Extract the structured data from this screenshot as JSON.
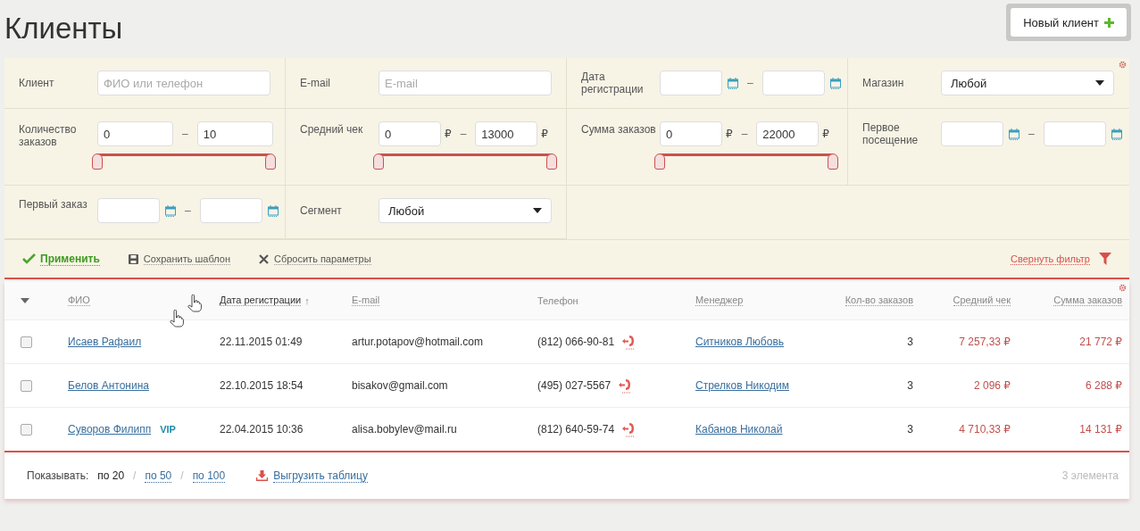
{
  "page": {
    "title": "Клиенты",
    "new_button": "Новый клиент"
  },
  "filters": [
    {
      "kind": "text",
      "label": "Клиент",
      "placeholder": "ФИО или телефон"
    },
    {
      "kind": "text",
      "label": "E-mail",
      "placeholder": "E-mail"
    },
    {
      "kind": "date_range",
      "label": "Дата регистрации",
      "dash": "–"
    },
    {
      "kind": "select",
      "label": "Магазин",
      "value": "Любой"
    },
    {
      "kind": "number_range",
      "label": "Количество заказов",
      "from": "0",
      "to": "10",
      "dash": "–",
      "thumbs": [
        {
          "level": 0
        },
        {
          "level": 1
        }
      ]
    },
    {
      "kind": "number_range",
      "label": "Средний чек",
      "from": "0",
      "to": "13000",
      "dash": "–",
      "currency": "₽",
      "thumbs": [
        {
          "level": 0
        },
        {
          "level": 1
        }
      ]
    },
    {
      "kind": "number_range",
      "label": "Сумма заказов",
      "from": "0",
      "to": "22000",
      "dash": "–",
      "currency": "₽",
      "thumbs": [
        {
          "level": 0
        },
        {
          "level": 1
        }
      ]
    },
    {
      "kind": "date_range",
      "label": "Первое посещение",
      "dash": "–"
    },
    {
      "kind": "date_range",
      "label": "Первый заказ",
      "dash": "–"
    },
    {
      "kind": "select",
      "label": "Сегмент",
      "value": "Любой"
    }
  ],
  "actions": {
    "apply": "Применить",
    "save": "Сохранить шаблон",
    "reset": "Сбросить параметры",
    "collapse": "Свернуть фильтр"
  },
  "table": {
    "columns": [
      {
        "label": "ФИО",
        "kind": "text",
        "sorted": false
      },
      {
        "label": "Дата регистрации",
        "kind": "text",
        "sorted": true,
        "sort_mark": "↑"
      },
      {
        "label": "E-mail",
        "kind": "text",
        "sorted": false
      },
      {
        "label": "Телефон",
        "kind": "plain",
        "sorted": false
      },
      {
        "label": "Менеджер",
        "kind": "text",
        "sorted": false
      },
      {
        "label": "Кол-во заказов",
        "kind": "number",
        "sorted": false
      },
      {
        "label": "Средний чек",
        "kind": "number",
        "sorted": false
      },
      {
        "label": "Сумма заказов",
        "kind": "number",
        "sorted": false
      }
    ],
    "rows": [
      {
        "checked": false,
        "name": "Исаев Рафаил",
        "date": "22.11.2015 01:49",
        "email": "artur.potapov@hotmail.com",
        "phone": "(812) 066-90-81",
        "manager": "Ситников Любовь",
        "orders": "3",
        "average": "7 257,33 ₽",
        "total": "21 772 ₽"
      },
      {
        "checked": false,
        "name": "Белов Антонина",
        "date": "22.10.2015 18:54",
        "email": "bisakov@gmail.com",
        "phone": "(495) 027-5567",
        "manager": "Стрелков Никодим",
        "orders": "3",
        "average": "2 096 ₽",
        "total": "6 288 ₽"
      },
      {
        "checked": false,
        "name": "Суворов Филипп",
        "badge": "VIP",
        "date": "22.04.2015 10:36",
        "email": "alisa.bobylev@mail.ru",
        "phone": "(812) 640-59-74",
        "manager": "Кабанов Николай",
        "orders": "3",
        "average": "4 710,33 ₽",
        "total": "14 131 ₽"
      }
    ]
  },
  "footer": {
    "show_label": "Показывать:",
    "page_sizes": [
      {
        "label": "по 20",
        "selected": true
      },
      {
        "label": "по 50",
        "selected": false
      },
      {
        "label": "по 100",
        "selected": false
      }
    ],
    "separator": "/",
    "export": "Выгрузить таблицу",
    "count": "3 элемента"
  }
}
